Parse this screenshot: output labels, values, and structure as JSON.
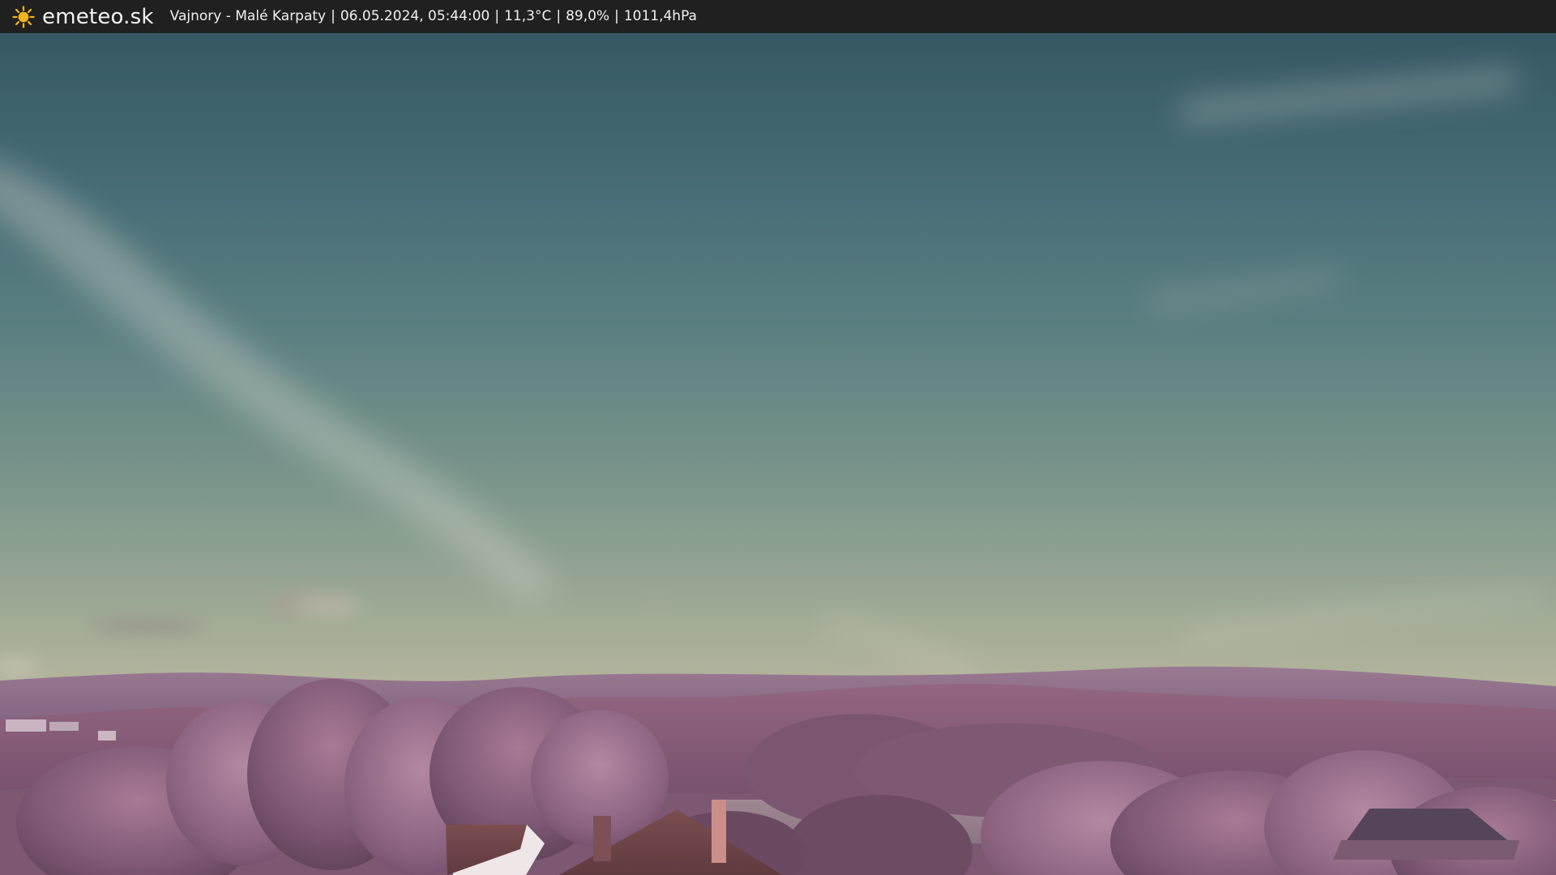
{
  "header": {
    "brand": "emeteo.sk",
    "location": "Vajnory - Malé Karpaty",
    "datetime": "06.05.2024, 05:44:00",
    "temperature": "11,3°C",
    "humidity": "89,0%",
    "pressure": "1011,4hPa",
    "separator": "|",
    "icon": "sun-icon"
  },
  "colors": {
    "topbar": "#202020",
    "sky_top": "#365863",
    "sky_mid": "#66887f",
    "sky_horizon": "#b8b29b",
    "hills": "#8f6585",
    "trees": "#815a78"
  }
}
